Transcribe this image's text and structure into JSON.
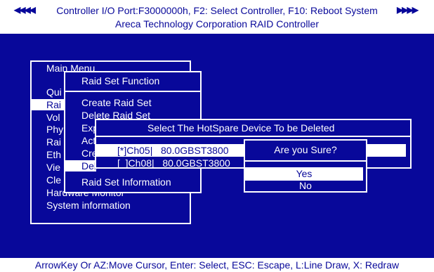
{
  "header": {
    "left_arrows": "◀◀◀◀",
    "line1": "Controller I/O Port:F3000000h, F2: Select Controller, F10: Reboot System",
    "right_arrows": "▶▶▶▶",
    "line2": "Areca Technology Corporation RAID Controller"
  },
  "main_menu": {
    "title": "Main Menu",
    "items": [
      "Qui",
      "Rai",
      "Vol",
      "Phy",
      "Rai",
      "Eth",
      "Vie",
      "Cle",
      "Hardware Monitor",
      "System information"
    ]
  },
  "raid_set_menu": {
    "title": "Raid Set Function",
    "items": [
      "Create Raid Set",
      "Delete Raid Set",
      "Exp",
      "Act",
      "Cre",
      "Del",
      "Raid Set Information"
    ]
  },
  "hotspare_dialog": {
    "title": "Select The HotSpare Device To be Deleted",
    "devices": [
      "[*]Ch05|   80.0GBST3800",
      "[  ]Ch08|   80.0GBST3800"
    ]
  },
  "confirm_dialog": {
    "title": "Are you Sure?",
    "yes": "Yes",
    "no": "No"
  },
  "status_bar": {
    "text": "ArrowKey Or AZ:Move Cursor, Enter: Select, ESC: Escape, L:Line Draw, X: Redraw"
  },
  "colors": {
    "background": "#08089a",
    "foreground": "#ffffff"
  }
}
